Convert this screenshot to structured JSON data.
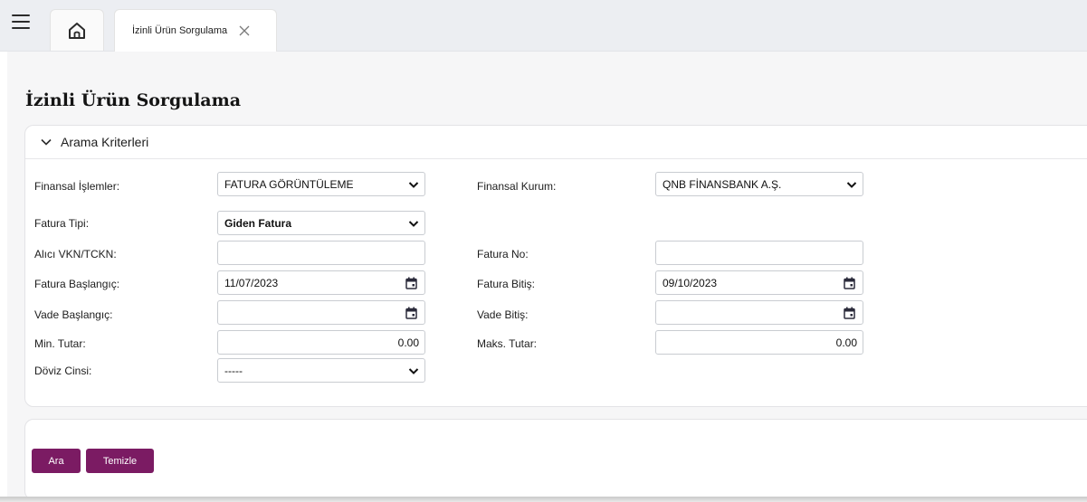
{
  "tabs": {
    "home_icon": "home-icon",
    "active_label": "İzinli Ürün Sorgulama"
  },
  "page": {
    "title": "İzinli Ürün Sorgulama"
  },
  "panel": {
    "title": "Arama Kriterleri"
  },
  "form": {
    "finansal_islemler": {
      "label": "Finansal İşlemler:",
      "value": "FATURA GÖRÜNTÜLEME"
    },
    "finansal_kurum": {
      "label": "Finansal Kurum:",
      "value": "QNB FİNANSBANK A.Ş."
    },
    "fatura_tipi": {
      "label": "Fatura Tipi:",
      "value": "Giden Fatura"
    },
    "alici_vkn": {
      "label": "Alıcı VKN/TCKN:",
      "value": ""
    },
    "fatura_no": {
      "label": "Fatura No:",
      "value": ""
    },
    "fatura_baslangic": {
      "label": "Fatura Başlangıç:",
      "value": "11/07/2023"
    },
    "fatura_bitis": {
      "label": "Fatura Bitiş:",
      "value": "09/10/2023"
    },
    "vade_baslangic": {
      "label": "Vade Başlangıç:",
      "value": ""
    },
    "vade_bitis": {
      "label": "Vade Bitiş:",
      "value": ""
    },
    "min_tutar": {
      "label": "Min. Tutar:",
      "value": "0.00"
    },
    "maks_tutar": {
      "label": "Maks. Tutar:",
      "value": "0.00"
    },
    "doviz_cinsi": {
      "label": "Döviz Cinsi:",
      "value": "-----"
    }
  },
  "buttons": {
    "search": "Ara",
    "clear": "Temizle"
  },
  "colors": {
    "accent": "#7b1b63",
    "topbar": "#eceef2",
    "background": "#f6f6f7"
  }
}
